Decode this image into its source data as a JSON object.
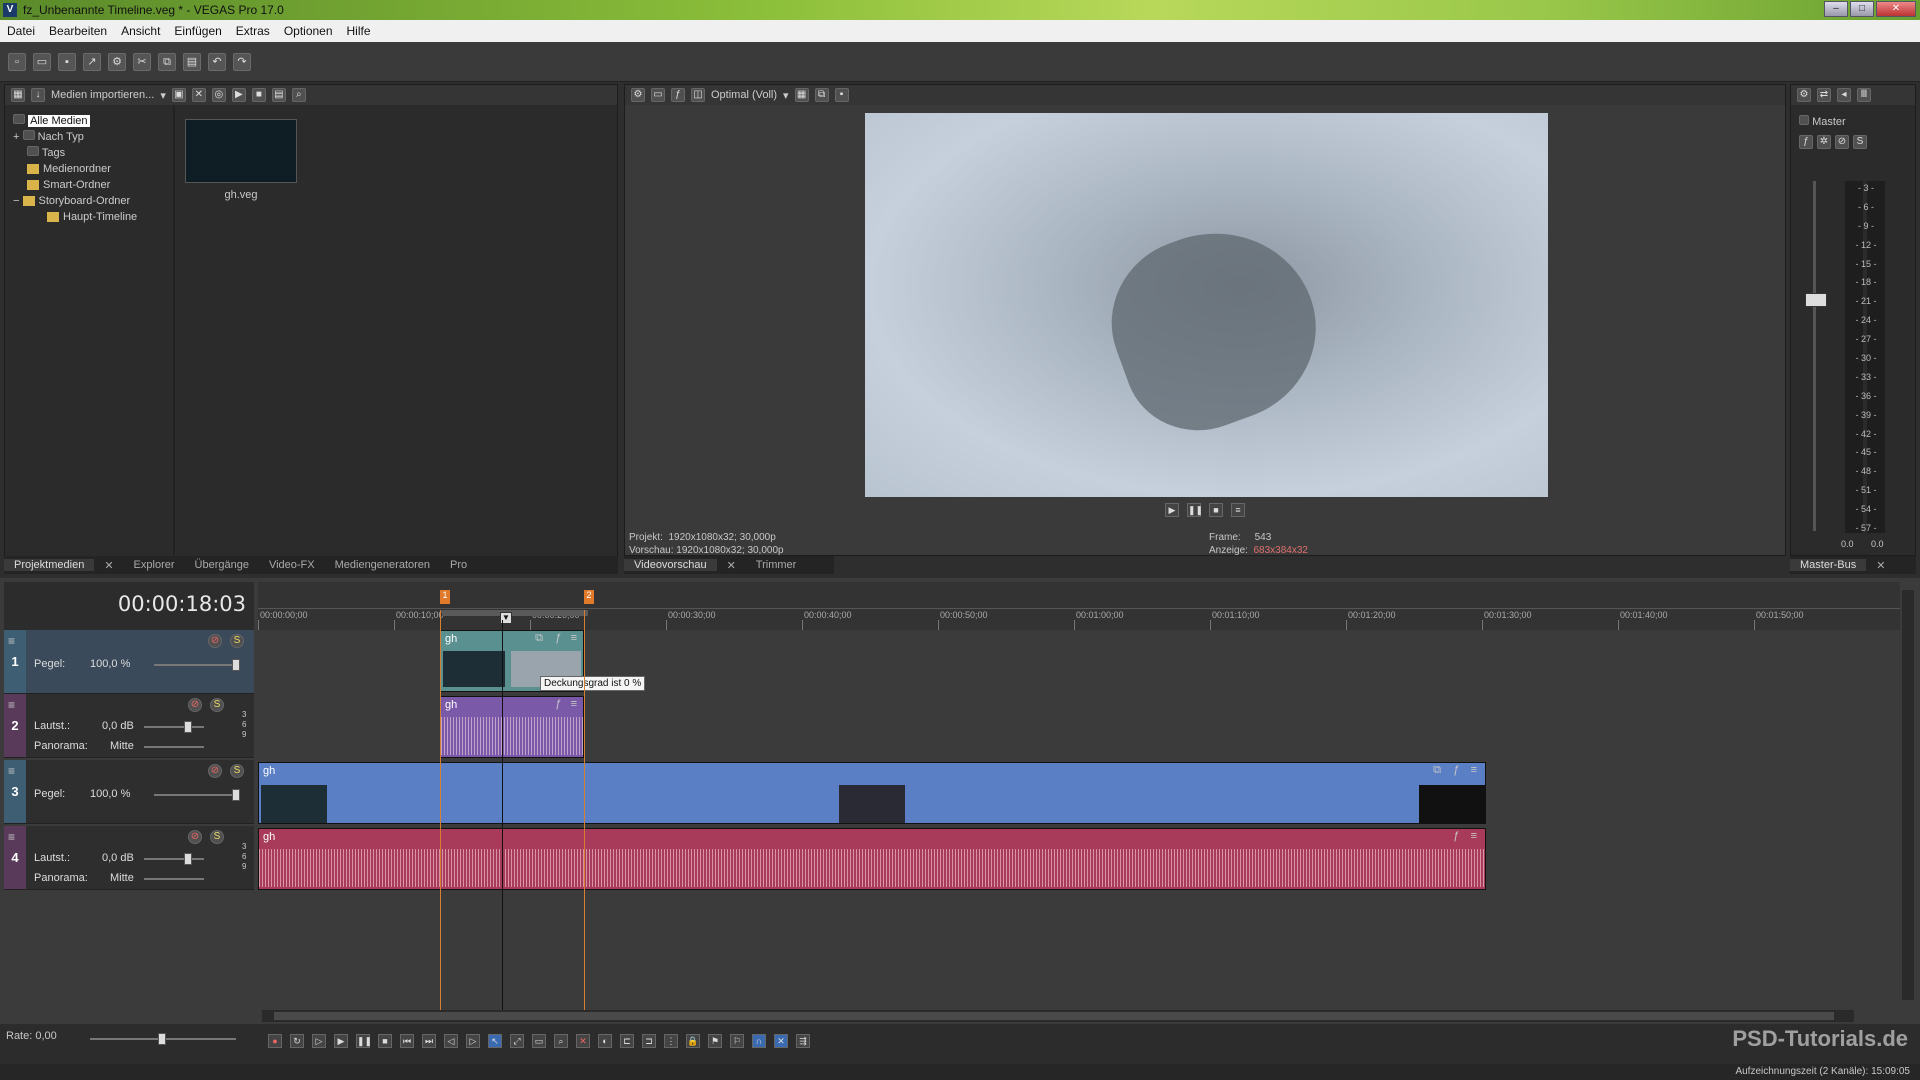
{
  "window": {
    "title": "fz_Unbenannte Timeline.veg * - VEGAS Pro 17.0",
    "app_icon": "V",
    "minimize": "–",
    "maximize": "□",
    "close": "✕"
  },
  "menu": {
    "items": [
      "Datei",
      "Bearbeiten",
      "Ansicht",
      "Einfügen",
      "Extras",
      "Optionen",
      "Hilfe"
    ]
  },
  "media_panel": {
    "import_label": "Medien importieren...",
    "tree": [
      {
        "label": "Alle Medien",
        "selected": true
      },
      {
        "label": "Nach Typ"
      },
      {
        "label": "Tags"
      },
      {
        "label": "Medienordner"
      },
      {
        "label": "Smart-Ordner"
      },
      {
        "label": "Storyboard-Ordner"
      },
      {
        "label": "Haupt-Timeline"
      }
    ],
    "expand_nach_typ": "+",
    "expand_storyboard": "−",
    "thumb_label": "gh.veg",
    "tabs": [
      "Projektmedien",
      "Explorer",
      "Übergänge",
      "Video-FX",
      "Mediengeneratoren",
      "Pro"
    ]
  },
  "preview": {
    "quality": "Optimal (Voll)",
    "project_label": "Projekt:",
    "project_value": "1920x1080x32; 30,000p",
    "preview_label": "Vorschau:",
    "preview_value": "1920x1080x32; 30,000p",
    "frame_label": "Frame:",
    "frame_value": "543",
    "display_label": "Anzeige:",
    "display_value": "683x384x32",
    "tabs": [
      "Videovorschau",
      "Trimmer"
    ]
  },
  "master": {
    "label": "Master",
    "db_scale": [
      "3",
      "6",
      "9",
      "12",
      "15",
      "18",
      "21",
      "24",
      "27",
      "30",
      "33",
      "36",
      "39",
      "42",
      "45",
      "48",
      "51",
      "54",
      "57"
    ],
    "readout_left": "0.0",
    "readout_right": "0.0",
    "tab": "Master-Bus"
  },
  "timeline": {
    "timecode": "00:00:18:03",
    "ruler": [
      "00:00:00;00",
      "00:00:10;00",
      "00:00:20;00",
      "00:00:30;00",
      "00:00:40;00",
      "00:00:50;00",
      "00:01:00;00",
      "00:01:10;00",
      "00:01:20;00",
      "00:01:30;00",
      "00:01:40;00",
      "00:01:50;00"
    ],
    "markers": [
      "1",
      "2"
    ],
    "tracks": [
      {
        "num": "1",
        "type": "video",
        "level_label": "Pegel:",
        "level_value": "100,0 %"
      },
      {
        "num": "2",
        "type": "audio",
        "vol_label": "Lautst.:",
        "vol_value": "0,0 dB",
        "pan_label": "Panorama:",
        "pan_value": "Mitte"
      },
      {
        "num": "3",
        "type": "video",
        "level_label": "Pegel:",
        "level_value": "100,0 %"
      },
      {
        "num": "4",
        "type": "audio",
        "vol_label": "Lautst.:",
        "vol_value": "0,0 dB",
        "pan_label": "Panorama:",
        "pan_value": "Mitte"
      }
    ],
    "audio_scale": [
      "3",
      "6",
      "9"
    ],
    "clip_name": "gh",
    "tooltip": "Deckungsgrad ist 0 %",
    "rate": "Rate: 0,00"
  },
  "status": {
    "recording": "Aufzeichnungszeit (2 Kanäle): 15:09:05"
  },
  "watermark": "PSD-Tutorials.de",
  "colors": {
    "video_track": "#5b7fc4",
    "audio_track": "#a83a5a",
    "audio_clip2": "#7a5aa8",
    "video_clip1": "#5a9090"
  }
}
